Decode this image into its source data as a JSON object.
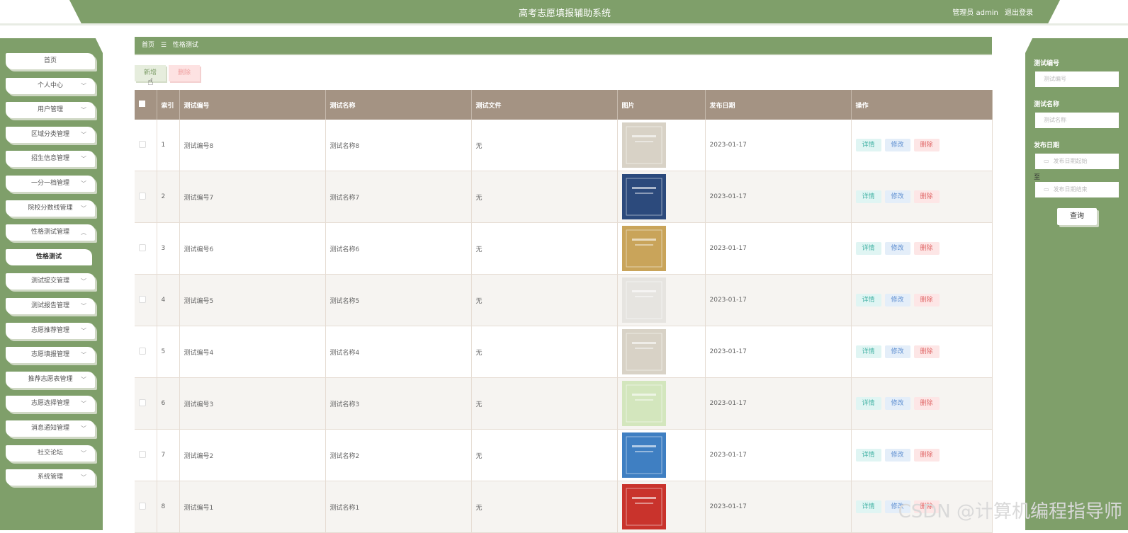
{
  "header": {
    "title": "高考志愿填报辅助系统",
    "role": "管理员 admin",
    "logout": "退出登录"
  },
  "sidebar": {
    "items": [
      {
        "label": "首页",
        "expandable": false
      },
      {
        "label": "个人中心",
        "expandable": true
      },
      {
        "label": "用户管理",
        "expandable": true
      },
      {
        "label": "区域分类管理",
        "expandable": true
      },
      {
        "label": "招生信息管理",
        "expandable": true
      },
      {
        "label": "一分一档管理",
        "expandable": true
      },
      {
        "label": "院校分数线管理",
        "expandable": true
      },
      {
        "label": "性格测试管理",
        "expandable": true,
        "expanded": true
      },
      {
        "label": "性格测试",
        "expandable": false,
        "active": true
      },
      {
        "label": "测试提交管理",
        "expandable": true
      },
      {
        "label": "测试报告管理",
        "expandable": true
      },
      {
        "label": "志愿推荐管理",
        "expandable": true
      },
      {
        "label": "志愿填报管理",
        "expandable": true
      },
      {
        "label": "推荐志愿表管理",
        "expandable": true
      },
      {
        "label": "志愿选择管理",
        "expandable": true
      },
      {
        "label": "消息通知管理",
        "expandable": true
      },
      {
        "label": "社交论坛",
        "expandable": true
      },
      {
        "label": "系统管理",
        "expandable": true
      }
    ]
  },
  "breadcrumb": {
    "home": "首页",
    "separator": "☰",
    "current": "性格测试"
  },
  "toolbar": {
    "add_label": "新增",
    "delete_label": "删除"
  },
  "table": {
    "headers": {
      "index": "索引",
      "test_no": "测试编号",
      "test_name": "测试名称",
      "test_file": "测试文件",
      "image": "图片",
      "publish_date": "发布日期",
      "actions": "操作"
    },
    "rows": [
      {
        "index": "1",
        "test_no": "测试编号8",
        "test_name": "测试名称8",
        "test_file": "无",
        "date": "2023-01-17",
        "thumb": "#d8d2c6"
      },
      {
        "index": "2",
        "test_no": "测试编号7",
        "test_name": "测试名称7",
        "test_file": "无",
        "date": "2023-01-17",
        "thumb": "#2c4a7c"
      },
      {
        "index": "3",
        "test_no": "测试编号6",
        "test_name": "测试名称6",
        "test_file": "无",
        "date": "2023-01-17",
        "thumb": "#c9a45a"
      },
      {
        "index": "4",
        "test_no": "测试编号5",
        "test_name": "测试名称5",
        "test_file": "无",
        "date": "2023-01-17",
        "thumb": "#e6e4e0"
      },
      {
        "index": "5",
        "test_no": "测试编号4",
        "test_name": "测试名称4",
        "test_file": "无",
        "date": "2023-01-17",
        "thumb": "#d8d2c6"
      },
      {
        "index": "6",
        "test_no": "测试编号3",
        "test_name": "测试名称3",
        "test_file": "无",
        "date": "2023-01-17",
        "thumb": "#d3e6bd"
      },
      {
        "index": "7",
        "test_no": "测试编号2",
        "test_name": "测试名称2",
        "test_file": "无",
        "date": "2023-01-17",
        "thumb": "#3f7fc2"
      },
      {
        "index": "8",
        "test_no": "测试编号1",
        "test_name": "测试名称1",
        "test_file": "无",
        "date": "2023-01-17",
        "thumb": "#c9332c"
      }
    ],
    "actions": {
      "detail": "详情",
      "edit": "修改",
      "delete": "删除"
    }
  },
  "search": {
    "test_no_label": "测试编号",
    "test_no_placeholder": "测试编号",
    "test_name_label": "测试名称",
    "test_name_placeholder": "测试名称",
    "date_label": "发布日期",
    "date_start_placeholder": "发布日期起始",
    "date_to": "至",
    "date_end_placeholder": "发布日期结束",
    "query_label": "查询"
  },
  "watermark": "CSDN @计算机编程指导师",
  "colors": {
    "primary": "#7f9f6a",
    "table_header": "#a49383"
  }
}
